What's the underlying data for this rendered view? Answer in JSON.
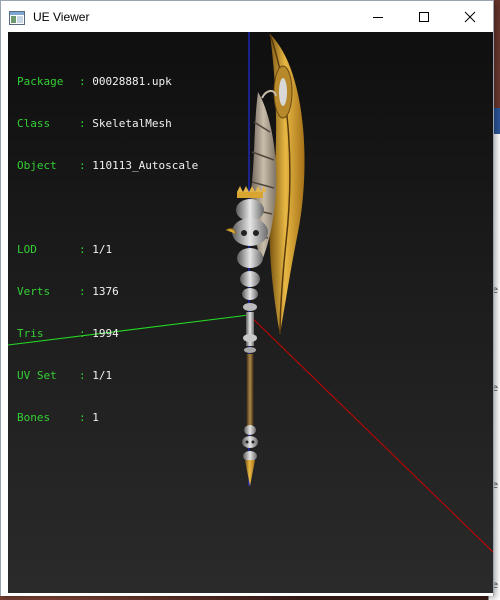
{
  "window": {
    "title": "UE Viewer",
    "controls": {
      "minimize": "minimize",
      "maximize": "maximize",
      "close": "close"
    }
  },
  "info_panel": {
    "group1": [
      {
        "label": "Package",
        "value": "00028881.upk"
      },
      {
        "label": "Class",
        "value": "SkeletalMesh"
      },
      {
        "label": "Object",
        "value": "110113_Autoscale"
      }
    ],
    "group2": [
      {
        "label": "LOD",
        "value": "1/1"
      },
      {
        "label": "Verts",
        "value": "1376"
      },
      {
        "label": "Tris",
        "value": "1994"
      },
      {
        "label": "UV Set",
        "value": "1/1"
      },
      {
        "label": "Bones",
        "value": "1"
      }
    ]
  },
  "colors": {
    "label_green": "#34d034",
    "axis_x": "#cc0000",
    "axis_y": "#22dd22",
    "axis_z": "#2233ff",
    "blade_gold": "#d9a531"
  },
  "icons": {
    "app": "app-window-icon",
    "minimize": "minimize-icon",
    "maximize": "maximize-icon",
    "close": "close-icon"
  }
}
